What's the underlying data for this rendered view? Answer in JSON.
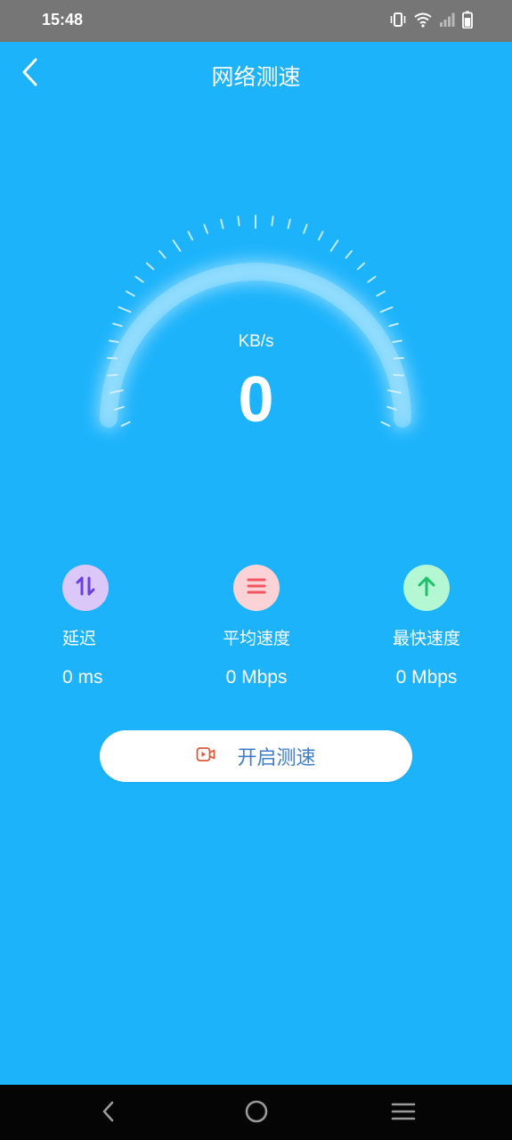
{
  "status_bar": {
    "time": "15:48",
    "icons": [
      "vibrate-icon",
      "wifi-icon",
      "signal-icon",
      "battery-icon"
    ]
  },
  "app_bar": {
    "title": "网络测速",
    "back_icon": "chevron-left-icon"
  },
  "gauge": {
    "unit": "KB/s",
    "value": "0",
    "level": 0
  },
  "stats": [
    {
      "icon": "updown-arrows-icon",
      "label": "延迟",
      "value": "0 ms",
      "icon_bg": "#dcc7f9",
      "icon_color": "#6a3fe0"
    },
    {
      "icon": "menu-lines-icon",
      "label": "平均速度",
      "value": "0 Mbps",
      "icon_bg": "#fbd3d7",
      "icon_color": "#f0555f"
    },
    {
      "icon": "arrow-up-icon",
      "label": "最快速度",
      "value": "0 Mbps",
      "icon_bg": "#b3f7d3",
      "icon_color": "#1fc06a"
    }
  ],
  "start_button": {
    "label": "开启测速",
    "icon": "video-play-icon"
  },
  "nav_bar": {
    "buttons": [
      "nav-back-icon",
      "nav-home-icon",
      "nav-menu-icon"
    ]
  },
  "colors": {
    "background": "#1cb3fb",
    "status_bar": "#767676",
    "button_text": "#3f7ec7",
    "nav_bar": "#050505"
  }
}
